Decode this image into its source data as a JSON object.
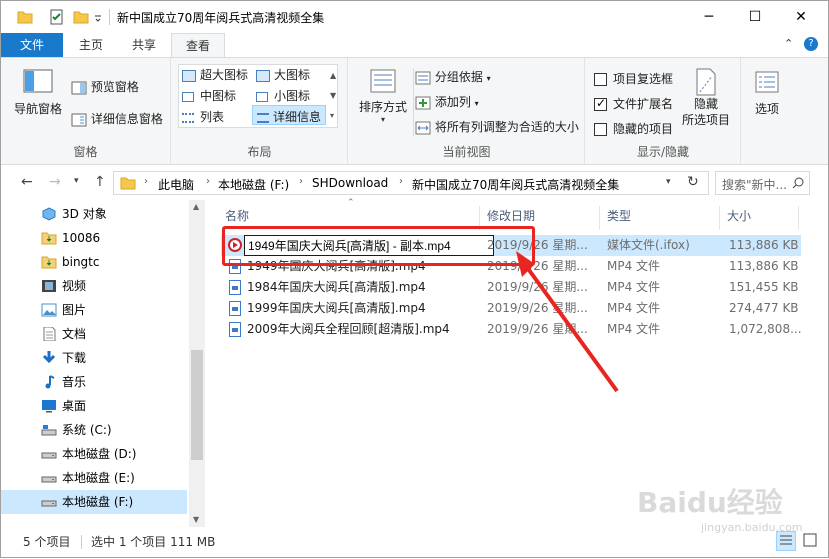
{
  "window": {
    "title": "新中国成立70周年阅兵式高清视频全集",
    "minimize": "─",
    "maximize": "☐",
    "close": "✕"
  },
  "ribbon_tabs": [
    "文件",
    "主页",
    "共享",
    "查看"
  ],
  "ribbon": {
    "panes": {
      "nav_pane": "导航窗格",
      "preview_pane": "预览窗格",
      "details_pane": "详细信息窗格",
      "label": "窗格"
    },
    "layout": {
      "items": [
        "超大图标",
        "大图标",
        "中图标",
        "小图标",
        "列表",
        "详细信息"
      ],
      "label": "布局"
    },
    "current_view": {
      "sort_by": "排序方式",
      "group_by": "分组依据",
      "add_column": "添加列",
      "fit_columns": "将所有列调整为合适的大小",
      "label": "当前视图"
    },
    "show_hide": {
      "item_checkbox": "项目复选框",
      "file_ext": "文件扩展名",
      "hidden_items": "隐藏的项目",
      "hide_selected_line1": "隐藏",
      "hide_selected_line2": "所选项目",
      "label": "显示/隐藏"
    },
    "options": "选项"
  },
  "address": {
    "crumbs": [
      "此电脑",
      "本地磁盘 (F:)",
      "SHDownload",
      "新中国成立70周年阅兵式高清视频全集"
    ],
    "search_placeholder": "搜索\"新中..."
  },
  "nav_items": [
    {
      "label": "3D 对象",
      "icon": "cube-icon",
      "color": "#3a8fd8"
    },
    {
      "label": "10086",
      "icon": "download-folder-icon",
      "color": "#e6b422"
    },
    {
      "label": "bingtc",
      "icon": "download-folder-icon",
      "color": "#e6b422"
    },
    {
      "label": "视频",
      "icon": "video-icon",
      "color": "#555555"
    },
    {
      "label": "图片",
      "icon": "picture-icon",
      "color": "#4a90c8"
    },
    {
      "label": "文档",
      "icon": "document-icon",
      "color": "#6b6b6b"
    },
    {
      "label": "下载",
      "icon": "download-arrow-icon",
      "color": "#1e6fbf"
    },
    {
      "label": "音乐",
      "icon": "music-icon",
      "color": "#1e6fbf"
    },
    {
      "label": "桌面",
      "icon": "desktop-icon",
      "color": "#1e6fbf"
    },
    {
      "label": "系统 (C:)",
      "icon": "system-drive-icon",
      "color": "#666666"
    },
    {
      "label": "本地磁盘 (D:)",
      "icon": "drive-icon",
      "color": "#666666"
    },
    {
      "label": "本地磁盘 (E:)",
      "icon": "drive-icon",
      "color": "#666666"
    },
    {
      "label": "本地磁盘 (F:)",
      "icon": "drive-icon",
      "color": "#666666"
    }
  ],
  "columns": {
    "name": "名称",
    "date": "修改日期",
    "type": "类型",
    "size": "大小"
  },
  "files": [
    {
      "name": "1949年国庆大阅兵[高清版] - 副本.mp4",
      "date": "2019/9/26 星期...",
      "type": "媒体文件(.ifox)",
      "size": "113,886 KB"
    },
    {
      "name": "1949年国庆大阅兵[高清版].mp4",
      "date": "2019/9/26 星期...",
      "type": "MP4 文件",
      "size": "113,886 KB"
    },
    {
      "name": "1984年国庆大阅兵[高清版].mp4",
      "date": "2019/9/26 星期...",
      "type": "MP4 文件",
      "size": "151,455 KB"
    },
    {
      "name": "1999年国庆大阅兵[高清版].mp4",
      "date": "2019/9/26 星期...",
      "type": "MP4 文件",
      "size": "274,477 KB"
    },
    {
      "name": "2009年大阅兵全程回顾[超清版].mp4",
      "date": "2019/9/26 星期...",
      "type": "MP4 文件",
      "size": "1,072,808..."
    }
  ],
  "status": {
    "count": "5 个项目",
    "selected": "选中 1 个项目  111 MB"
  },
  "watermark": {
    "main": "Baidu经验",
    "sub": "jingyan.baidu.com"
  },
  "colors": {
    "accent": "#1979ca",
    "selection": "#cce8ff",
    "annotation": "#e8251f"
  }
}
